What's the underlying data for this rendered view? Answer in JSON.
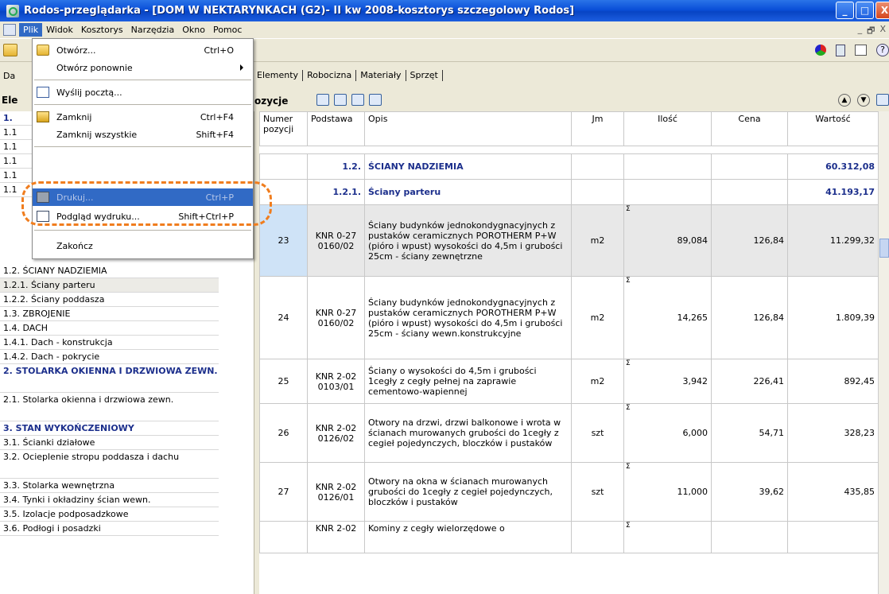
{
  "window": {
    "title": "Rodos-przeglądarka - [DOM W NEKTARYNKACH  (G2)- II kw 2008-kosztorys szczegolowy Rodos]",
    "controls": [
      "_",
      "□",
      "X"
    ]
  },
  "menubar": {
    "items": [
      "Plik",
      "Widok",
      "Kosztorys",
      "Narzędzia",
      "Okno",
      "Pomoc"
    ],
    "mdi_controls": [
      "_",
      "🗗",
      "X"
    ]
  },
  "file_menu": {
    "items": [
      {
        "label": "Otwórz...",
        "shortcut": "Ctrl+O",
        "icon": "open-folder-icon"
      },
      {
        "label": "Otwórz ponownie",
        "shortcut": "",
        "submenu": true
      },
      {
        "label": "Wyślij pocztą...",
        "shortcut": "",
        "icon": "envelope-icon"
      },
      {
        "label": "Zamknij",
        "shortcut": "Ctrl+F4",
        "icon": "door-icon"
      },
      {
        "label": "Zamknij wszystkie",
        "shortcut": "Shift+F4"
      },
      {
        "label": "Drukuj...",
        "shortcut": "Ctrl+P",
        "icon": "printer-icon",
        "highlighted": true,
        "disabled": true
      },
      {
        "label": "Podgląd wydruku...",
        "shortcut": "Shift+Ctrl+P",
        "icon": "print-preview-icon"
      },
      {
        "label": "Zakończ",
        "shortcut": ""
      }
    ]
  },
  "tabs_row": {
    "left_partial": "Da",
    "tabs": [
      "Elementy",
      "Robocizna",
      "Materiały",
      "Sprzęt"
    ]
  },
  "left_pane": {
    "header": "Ele",
    "tree": [
      {
        "label": "1.",
        "bold": true
      },
      {
        "label": "1.1",
        "bold": false
      },
      {
        "label": "1.1",
        "bold": false
      },
      {
        "label": "1.1",
        "bold": false
      },
      {
        "label": "1.1",
        "bold": false
      },
      {
        "label": "1.1",
        "bold": false
      },
      {
        "label": "1.2. ŚCIANY NADZIEMIA",
        "bold": false
      },
      {
        "label": "1.2.1. Ściany parteru",
        "bold": false,
        "selected": true
      },
      {
        "label": "1.2.2. Ściany poddasza",
        "bold": false
      },
      {
        "label": "1.3. ZBROJENIE",
        "bold": false
      },
      {
        "label": "1.4. DACH",
        "bold": false
      },
      {
        "label": "1.4.1. Dach - konstrukcja",
        "bold": false
      },
      {
        "label": "1.4.2. Dach - pokrycie",
        "bold": false
      },
      {
        "label": "2. STOLARKA OKIENNA I DRZWIOWA ZEWN.",
        "bold": true
      },
      {
        "label": "2.1. Stolarka okienna i drzwiowa zewn.",
        "bold": false
      },
      {
        "label": "3. STAN WYKOŃCZENIOWY",
        "bold": true
      },
      {
        "label": "3.1. Ścianki działowe",
        "bold": false
      },
      {
        "label": "3.2. Ocieplenie stropu poddasza i dachu",
        "bold": false
      },
      {
        "label": "3.3. Stolarka wewnętrzna",
        "bold": false
      },
      {
        "label": "3.4. Tynki i okładziny ścian wewn.",
        "bold": false
      },
      {
        "label": "3.5. Izolacje podposadzkowe",
        "bold": false
      },
      {
        "label": "3.6. Podłogi i posadzki",
        "bold": false
      }
    ]
  },
  "right_pane": {
    "header": "ozycje",
    "columns": [
      "Numer pozycji",
      "Podstawa",
      "Opis",
      "Jm",
      "Ilość",
      "Cena",
      "Wartość"
    ],
    "groups": [
      {
        "number": "1.2.",
        "name": "ŚCIANY NADZIEMIA",
        "value": "60.312,08"
      },
      {
        "number": "1.2.1.",
        "name": "Ściany parteru",
        "value": "41.193,17"
      }
    ],
    "rows": [
      {
        "num": "23",
        "basis": "KNR 0-27 0160/02",
        "desc": "Ściany budynków jednokondygnacyjnych z pustaków ceramicznych POROTHERM P+W (pióro i wpust) wysokości do 4,5m i grubości 25cm - ściany zewnętrzne",
        "unit": "m2",
        "qty": "89,084",
        "price": "126,84",
        "value": "11.299,32"
      },
      {
        "num": "24",
        "basis": "KNR 0-27 0160/02",
        "desc": "Ściany budynków jednokondygnacyjnych z pustaków ceramicznych POROTHERM P+W (pióro i wpust) wysokości do 4,5m i grubości 25cm - ściany wewn.konstrukcyjne",
        "unit": "m2",
        "qty": "14,265",
        "price": "126,84",
        "value": "1.809,39"
      },
      {
        "num": "25",
        "basis": "KNR 2-02 0103/01",
        "desc": "Ściany o wysokości do 4,5m i grubości 1cegły z cegły pełnej na zaprawie cementowo-wapiennej",
        "unit": "m2",
        "qty": "3,942",
        "price": "226,41",
        "value": "892,45"
      },
      {
        "num": "26",
        "basis": "KNR 2-02 0126/02",
        "desc": "Otwory na drzwi, drzwi balkonowe i wrota w ścianach murowanych grubości do 1cegły z cegieł pojedynczych, bloczków i pustaków",
        "unit": "szt",
        "qty": "6,000",
        "price": "54,71",
        "value": "328,23"
      },
      {
        "num": "27",
        "basis": "KNR 2-02 0126/01",
        "desc": "Otwory na okna w ścianach murowanych grubości do 1cegły z cegieł pojedynczych, bloczków i pustaków",
        "unit": "szt",
        "qty": "11,000",
        "price": "39,62",
        "value": "435,85"
      },
      {
        "num": "",
        "basis": "KNR 2-02",
        "desc": "Kominy z cegły wielorzędowe o",
        "unit": "",
        "qty": "",
        "price": "",
        "value": ""
      }
    ],
    "sigma": "Σ"
  },
  "colors": {
    "titlebar": "#0a4fd8",
    "menu_highlight": "#316ac5",
    "group_text": "#1c2f8c",
    "annotation_ring": "#f07d1e"
  }
}
